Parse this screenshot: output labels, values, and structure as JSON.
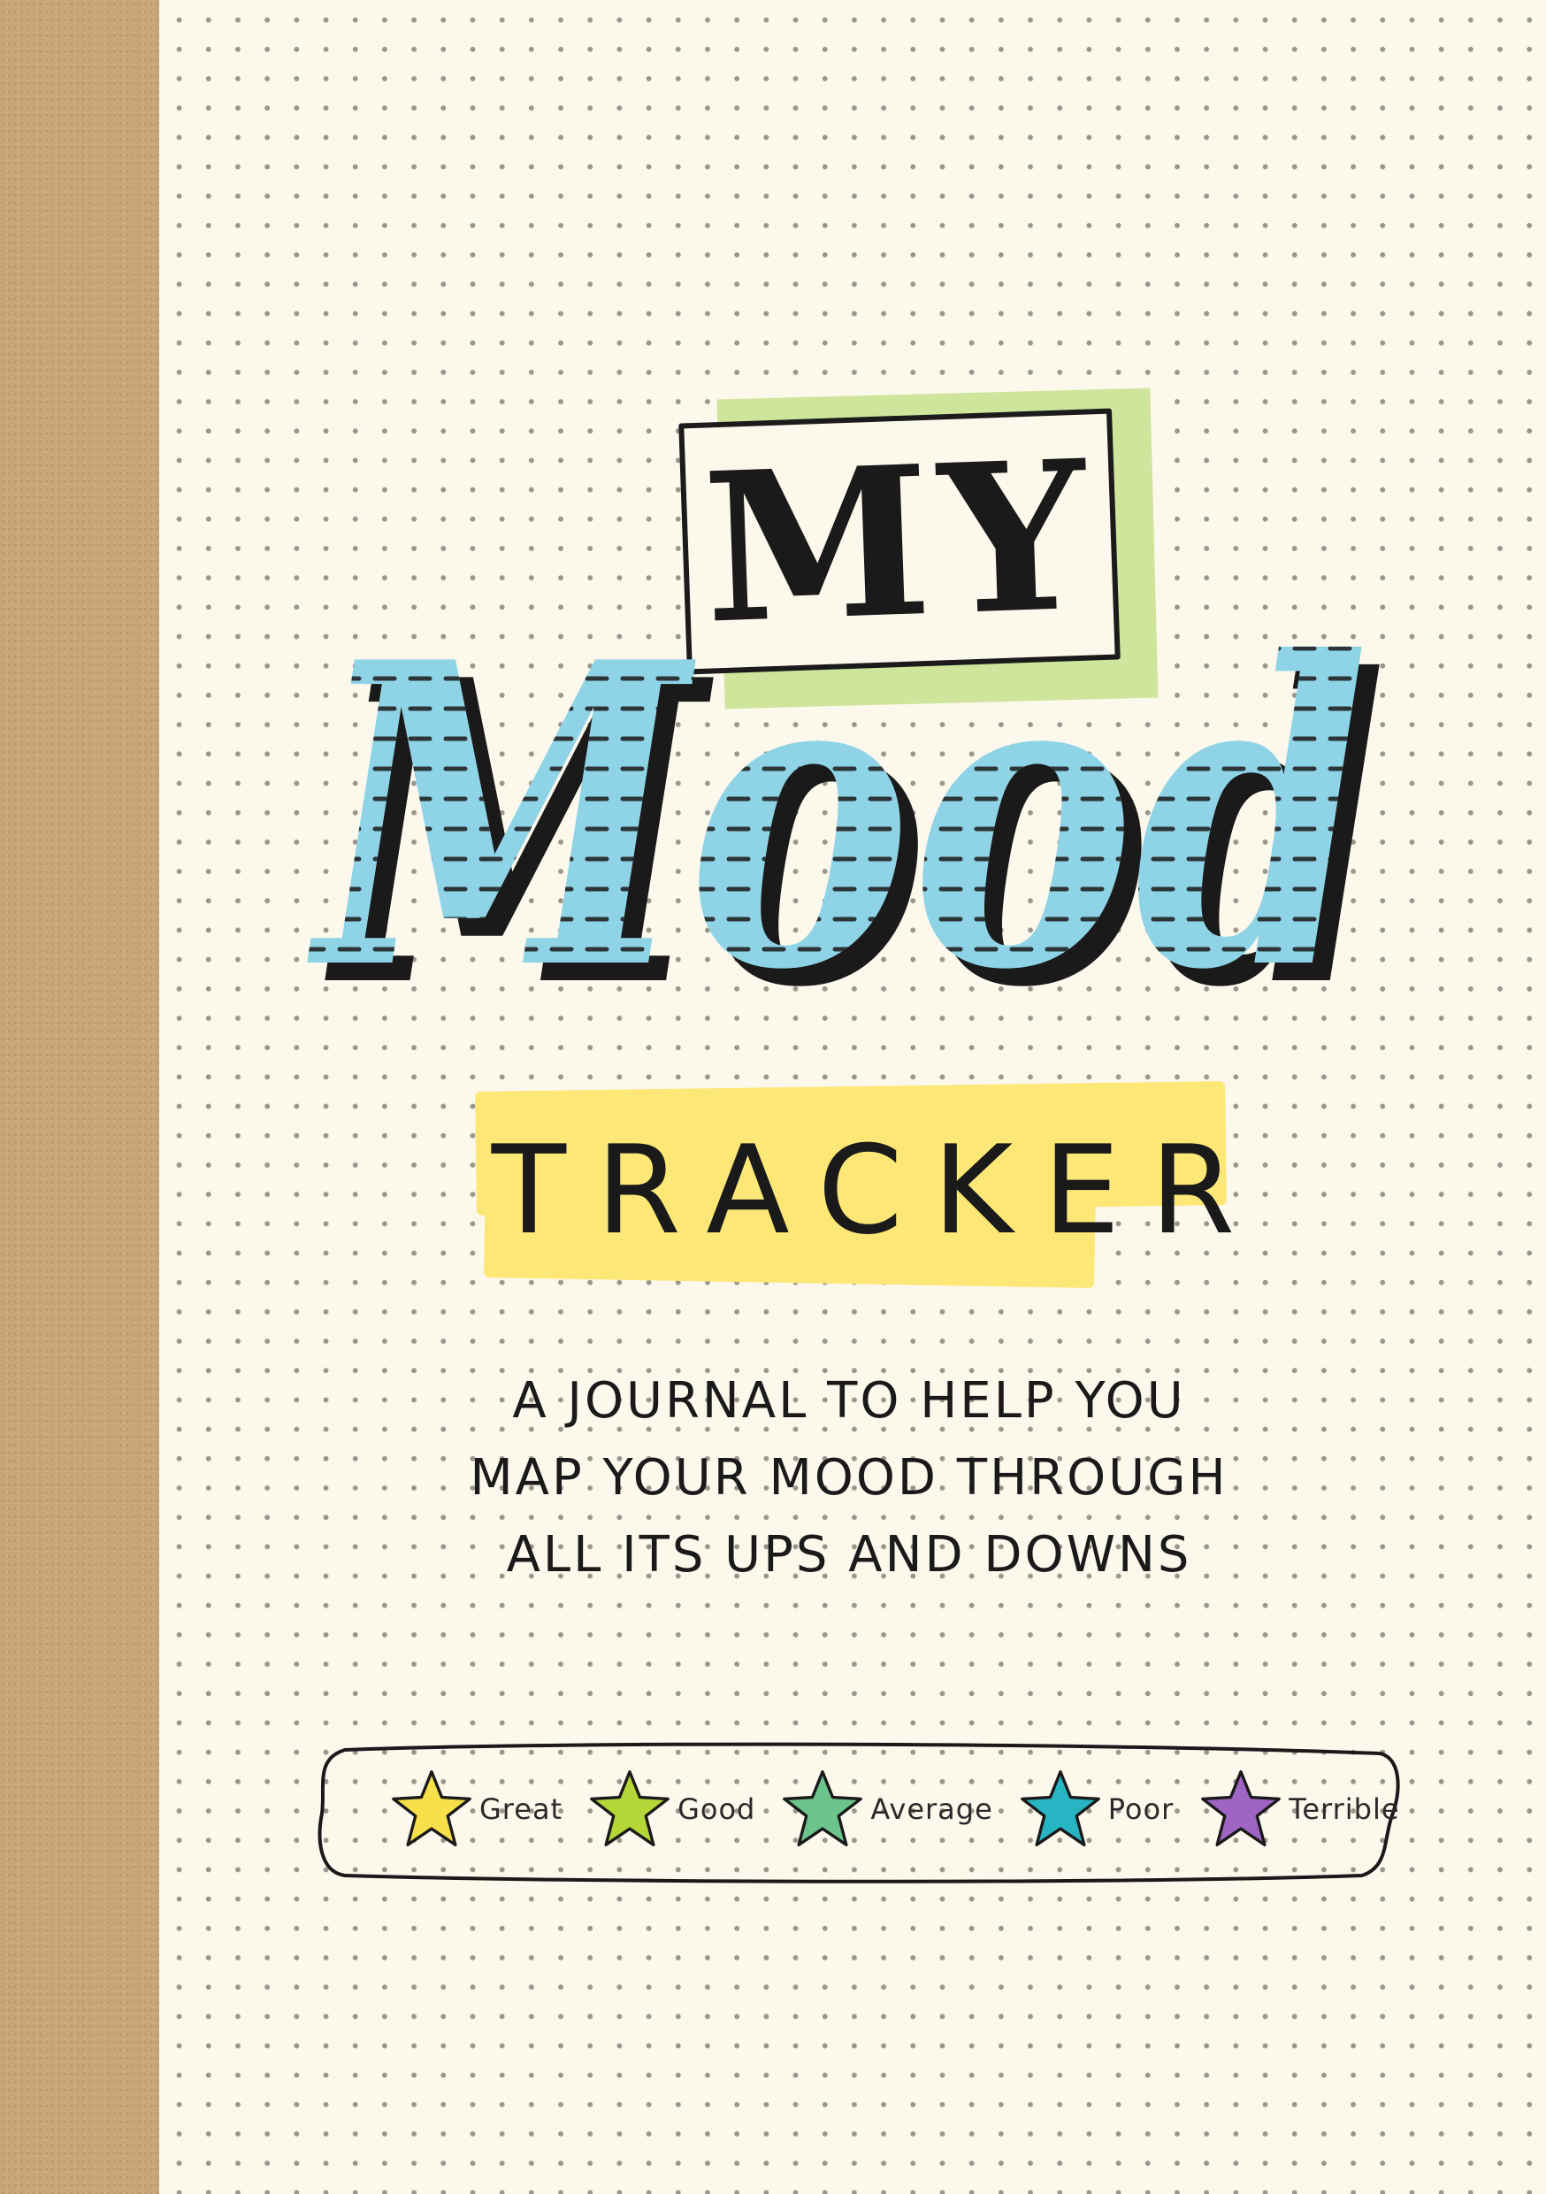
{
  "cover": {
    "title_my": "MY",
    "title_mood": "Mood",
    "title_tracker": "TRACKER",
    "subtitle_lines": [
      "A JOURNAL TO HELP YOU",
      "MAP YOUR MOOD THROUGH",
      "ALL ITS UPS AND DOWNS"
    ]
  },
  "legend": [
    {
      "label": "Great",
      "icon": "star-icon",
      "color": "#f7e04a"
    },
    {
      "label": "Good",
      "icon": "star-icon",
      "color": "#b4d636"
    },
    {
      "label": "Average",
      "icon": "star-icon",
      "color": "#6cc48a"
    },
    {
      "label": "Poor",
      "icon": "star-icon",
      "color": "#27b5c4"
    },
    {
      "label": "Terrible",
      "icon": "star-icon",
      "color": "#a064c4"
    }
  ],
  "colors": {
    "paper": "#fcf8ec",
    "kraft": "#c9a679",
    "mood_blue": "#8fd3e6",
    "my_highlight": "#cfe59c",
    "tracker_highlight": "#fde777"
  }
}
